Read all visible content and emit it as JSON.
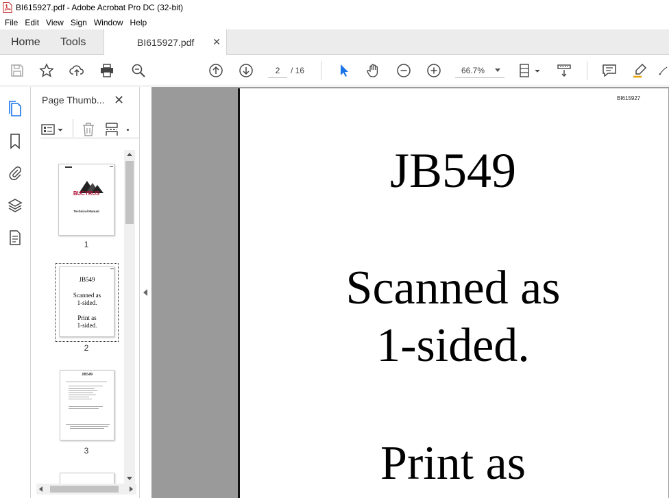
{
  "window": {
    "title": "BI615927.pdf - Adobe Acrobat Pro DC (32-bit)"
  },
  "menu": [
    "File",
    "Edit",
    "View",
    "Sign",
    "Window",
    "Help"
  ],
  "tabs": {
    "home": "Home",
    "tools": "Tools",
    "document": "BI615927.pdf",
    "close_glyph": "✕"
  },
  "toolbar": {
    "page_current": "2",
    "page_total": "/ 16",
    "zoom": "66.7%"
  },
  "sidebar": {
    "title": "Page Thumb...",
    "close_glyph": "✕",
    "thumbnails": [
      {
        "number": "1",
        "logo_text": "BUCYRUS",
        "subtitle": "Technical Manual"
      },
      {
        "number": "2",
        "lines": [
          "JB549",
          "Scanned as",
          "1-sided.",
          "Print as",
          "1-sided."
        ]
      },
      {
        "number": "3",
        "heading": "JB549"
      }
    ]
  },
  "document": {
    "header_code": "BI615927",
    "line1": "JB549",
    "line2": "Scanned as",
    "line3": "1-sided.",
    "line4": "Print as"
  },
  "colors": {
    "accent_blue": "#1a73e8",
    "tab_bg": "#ececec",
    "doc_bg": "#9a9a9a",
    "bucyrus_red": "#b0123a"
  }
}
